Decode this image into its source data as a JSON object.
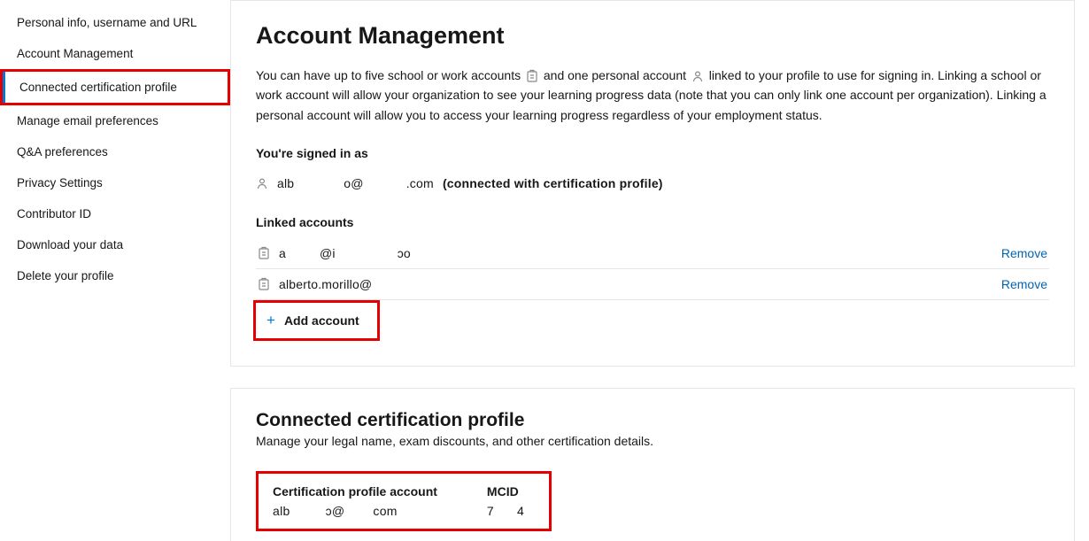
{
  "sidebar": {
    "items": [
      {
        "label": "Personal info, username and URL"
      },
      {
        "label": "Account Management"
      },
      {
        "label": "Connected certification profile",
        "active": true
      },
      {
        "label": "Manage email preferences"
      },
      {
        "label": "Q&A preferences"
      },
      {
        "label": "Privacy Settings"
      },
      {
        "label": "Contributor ID"
      },
      {
        "label": "Download your data"
      },
      {
        "label": "Delete your profile"
      }
    ]
  },
  "account": {
    "heading": "Account Management",
    "desc_1": "You can have up to five school or work accounts",
    "desc_2": "and one personal account",
    "desc_3": "linked to your profile to use for signing in. Linking a school or work account will allow your organization to see your learning progress data (note that you can only link one account per organization). Linking a personal account will allow you to access your learning progress regardless of your employment status.",
    "signed_in_label": "You're signed in as",
    "signed_in_p1": "alb",
    "signed_in_p2": "o@",
    "signed_in_p3": ".com",
    "signed_in_note": "(connected with certification profile)",
    "linked_label": "Linked accounts",
    "linked": [
      {
        "p1": "a",
        "p2": "@i",
        "p3": "ɔo",
        "remove": "Remove"
      },
      {
        "p1": "alberto.morillo@",
        "p2": "",
        "p3": "",
        "remove": "Remove"
      }
    ],
    "add_label": "Add account"
  },
  "cert": {
    "heading": "Connected certification profile",
    "desc": "Manage your legal name, exam discounts, and other certification details.",
    "col1_hdr": "Certification profile account",
    "col1_p1": "alb",
    "col1_p2": "ɔ@",
    "col1_p3": "com",
    "col2_hdr": "MCID",
    "col2_p1": "7",
    "col2_p2": "4"
  }
}
